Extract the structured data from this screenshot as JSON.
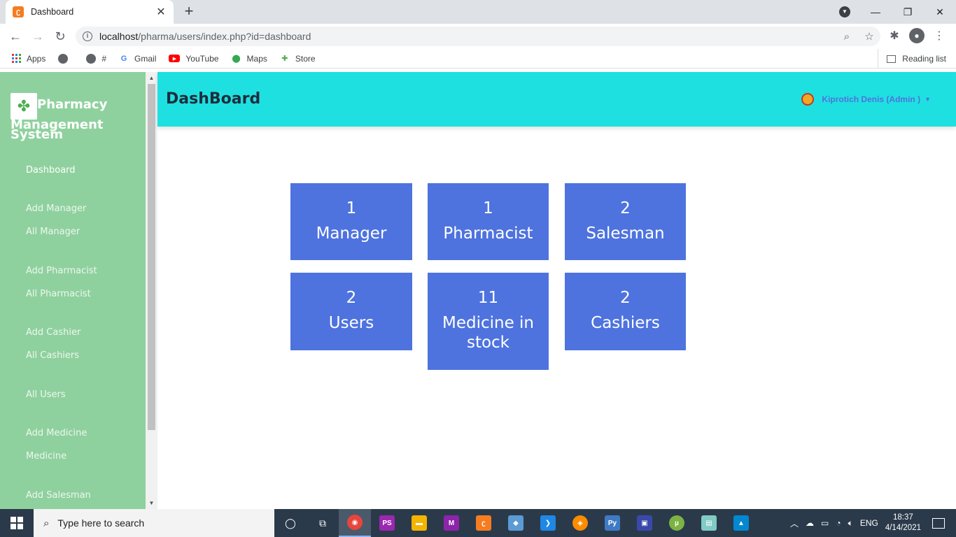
{
  "browser": {
    "tab_title": "Dashboard",
    "url_host": "localhost",
    "url_path": "/pharma/users/index.php?id=dashboard",
    "bookmarks": [
      {
        "label": "Apps",
        "icon": "apps-grid-icon"
      },
      {
        "label": "",
        "icon": "globe-icon"
      },
      {
        "label": "#",
        "icon": "globe-icon"
      },
      {
        "label": "Gmail",
        "icon": "google-icon"
      },
      {
        "label": "YouTube",
        "icon": "youtube-icon"
      },
      {
        "label": "Maps",
        "icon": "maps-pin-icon"
      },
      {
        "label": "Store",
        "icon": "store-icon"
      }
    ],
    "reading_list": "Reading list"
  },
  "sidebar": {
    "brand_line1": "Pharmacy",
    "brand_line2": "Management",
    "brand_line3": "System",
    "items": [
      {
        "label": "Dashboard",
        "active": true
      },
      {
        "label": "Add Manager"
      },
      {
        "label": "All Manager"
      },
      {
        "label": "Add Pharmacist"
      },
      {
        "label": "All Pharmacist"
      },
      {
        "label": "Add Cashier"
      },
      {
        "label": "All Cashiers"
      },
      {
        "label": "All Users"
      },
      {
        "label": "Add Medicine"
      },
      {
        "label": "Medicine"
      },
      {
        "label": "Add Salesman"
      }
    ]
  },
  "header": {
    "title": "DashBoard",
    "user": "Kiprotich Denis (Admin )"
  },
  "cards": [
    {
      "count": "1",
      "label": "Manager"
    },
    {
      "count": "1",
      "label": "Pharmacist"
    },
    {
      "count": "2",
      "label": "Salesman"
    },
    {
      "count": "2",
      "label": "Users"
    },
    {
      "count": "11",
      "label": "Medicine in stock"
    },
    {
      "count": "2",
      "label": "Cashiers"
    }
  ],
  "taskbar": {
    "search_placeholder": "Type here to search",
    "language": "ENG",
    "time": "18:37",
    "date": "4/14/2021"
  },
  "colors": {
    "sidebar_bg": "#8fd19e",
    "header_bg": "#1ee0e0",
    "card_bg": "#4e73df",
    "user_link": "#4e73df"
  }
}
